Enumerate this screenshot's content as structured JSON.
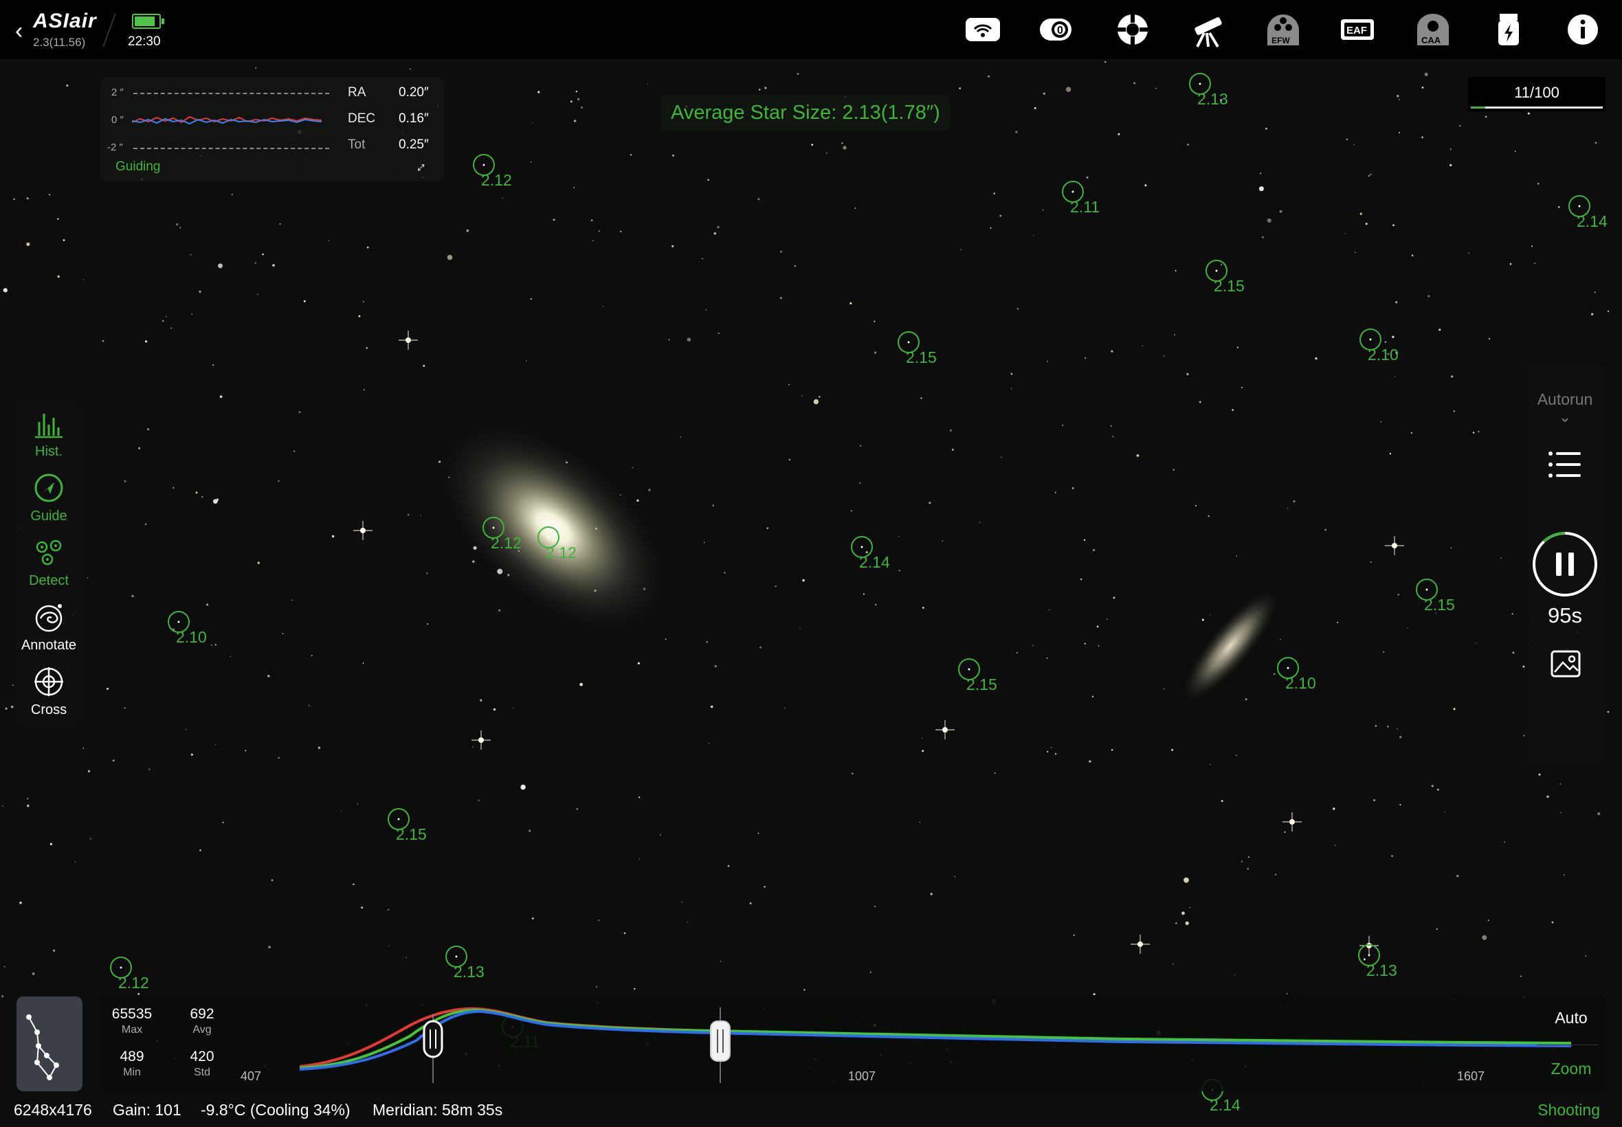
{
  "header": {
    "app_name": "ASIair",
    "version": "2.3(11.56)",
    "time": "22:30",
    "battery_level": 0.85,
    "icons": [
      "back-chevron-icon",
      "wifi-icon",
      "camera-icon",
      "guide-scope-icon",
      "telescope-icon",
      "efw-icon",
      "eaf-icon",
      "caa-icon",
      "usb-power-icon",
      "info-icon"
    ],
    "efw_label": "EFW",
    "eaf_label": "EAF",
    "caa_label": "CAA"
  },
  "guiding": {
    "axis_top": "2 ″",
    "axis_mid": "0 ″",
    "axis_bottom": "-2 ″",
    "ra_label": "RA",
    "ra_value": "0.20″",
    "dec_label": "DEC",
    "dec_value": "0.16″",
    "tot_label": "Tot",
    "tot_value": "0.25″",
    "status": "Guiding",
    "ra_color": "#3b82f6",
    "dec_color": "#e53935"
  },
  "average_star_size": "Average Star Size: 2.13(1.78″)",
  "frame_progress": {
    "text": "11/100",
    "fraction": 0.11
  },
  "left_tools": [
    {
      "label": "Hist.",
      "icon": "histogram-icon",
      "active": true
    },
    {
      "label": "Guide",
      "icon": "guide-arrow-icon",
      "active": true
    },
    {
      "label": "Detect",
      "icon": "detect-stars-icon",
      "active": true
    },
    {
      "label": "Annotate",
      "icon": "annotate-galaxy-icon",
      "active": false
    },
    {
      "label": "Cross",
      "icon": "crosshair-icon",
      "active": false
    }
  ],
  "right_panel": {
    "autorun_label": "Autorun",
    "countdown": "95s",
    "exposure_progress": 0.12
  },
  "star_labels": [
    "2.13",
    "2.12",
    "2.11",
    "2.14",
    "2.15",
    "2.15",
    "2.10",
    "2.12",
    "2.12",
    "2.14",
    "2.15",
    "2.10",
    "2.15",
    "2.10",
    "2.15",
    "2.12",
    "2.13",
    "2.13",
    "2.11",
    "2.14"
  ],
  "histogram": {
    "max_value": "65535",
    "max_label": "Max",
    "avg_value": "692",
    "avg_label": "Avg",
    "min_value": "489",
    "min_label": "Min",
    "std_value": "420",
    "std_label": "Std",
    "tick_left": "407",
    "tick_mid": "1007",
    "tick_right": "1607",
    "auto_label": "Auto",
    "zoom_label": "Zoom",
    "series_colors": [
      "#e53935",
      "#43c43b",
      "#2f6df0"
    ]
  },
  "status_bar": {
    "resolution": "6248x4176",
    "gain": "Gain: 101",
    "temperature": "-9.8°C (Cooling 34%)",
    "meridian": "Meridian: 58m 35s",
    "mode": "Shooting"
  },
  "colors": {
    "accent": "#3fb43a",
    "background": "#0c0d0c"
  }
}
